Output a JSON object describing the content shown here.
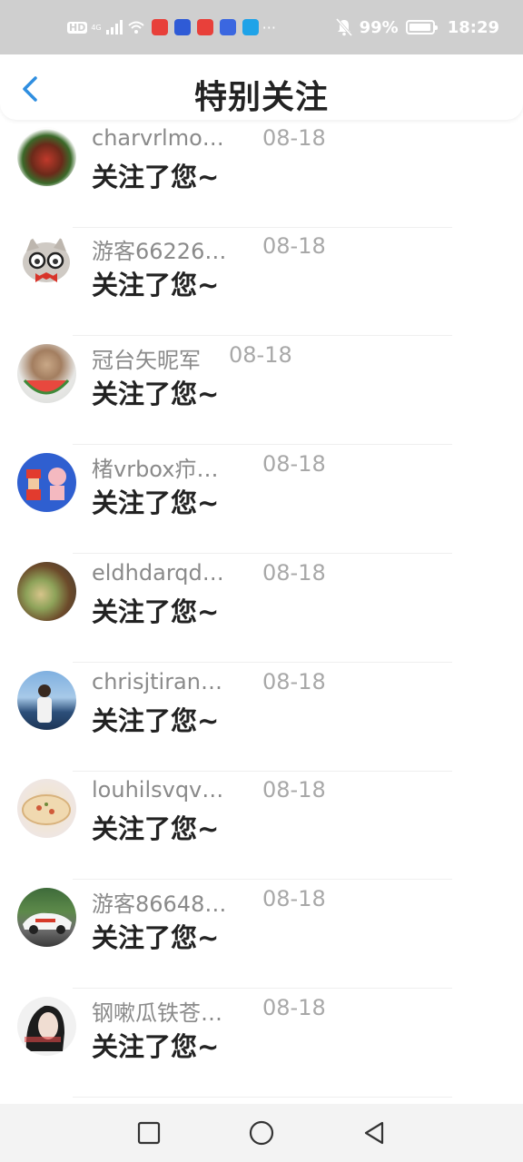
{
  "status_bar": {
    "hd_label": "HD",
    "network_label": "4G",
    "more_label": "···",
    "battery_percent": "99%",
    "time": "18:29",
    "app_icons": [
      "#e8403a",
      "#2f5bd6",
      "#e8403a",
      "#3b67e0",
      "#1fa3e8"
    ]
  },
  "header": {
    "title": "特别关注"
  },
  "colors": {
    "accent": "#2f8ee0",
    "name_gray": "#8a8a8a",
    "date_gray": "#a8a8a8"
  },
  "items": [
    {
      "name": "charvrlmo…",
      "date": "08-18",
      "message": "关注了您~"
    },
    {
      "name": "游客66226…",
      "date": "08-18",
      "message": "关注了您~"
    },
    {
      "name": "冠台矢昵军",
      "date": "08-18",
      "message": "关注了您~"
    },
    {
      "name": "楮vrbox疖…",
      "date": "08-18",
      "message": "关注了您~"
    },
    {
      "name": "eldhdarqd…",
      "date": "08-18",
      "message": "关注了您~"
    },
    {
      "name": "chrisjtiran…",
      "date": "08-18",
      "message": "关注了您~"
    },
    {
      "name": "louhilsvqv…",
      "date": "08-18",
      "message": "关注了您~"
    },
    {
      "name": "游客86648…",
      "date": "08-18",
      "message": "关注了您~"
    },
    {
      "name": "钢嗽瓜铁苍…",
      "date": "08-18",
      "message": "关注了您~"
    }
  ]
}
